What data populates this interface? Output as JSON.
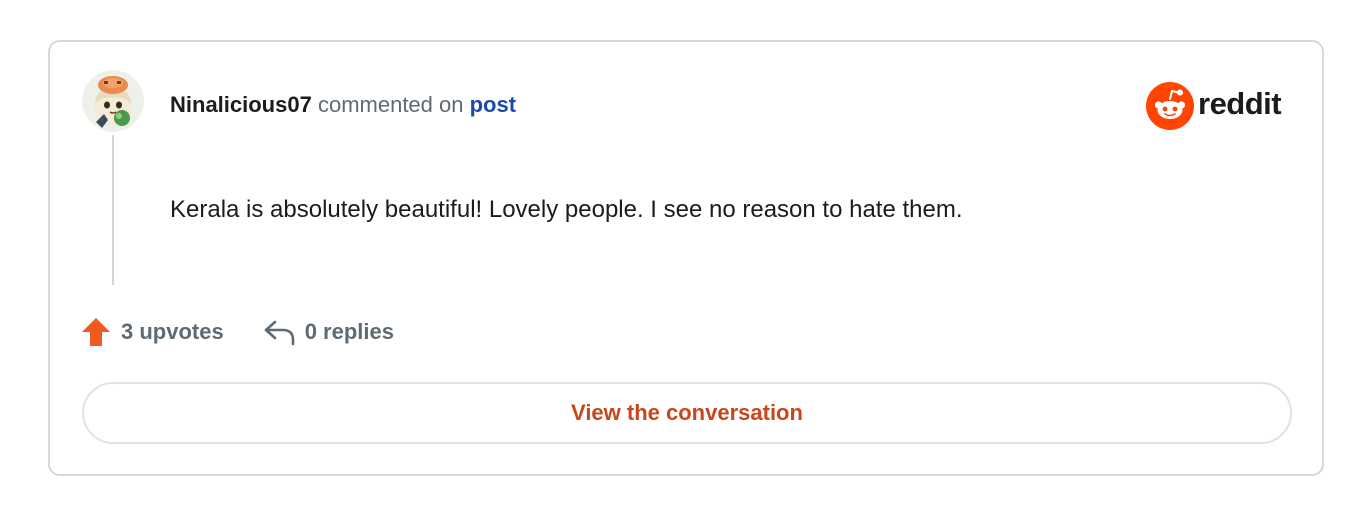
{
  "comment": {
    "username": "Ninalicious07",
    "action_text": " commented on ",
    "post_link": "post",
    "body": "Kerala is absolutely beautiful! Lovely people. I see no reason to hate them."
  },
  "brand": {
    "logo_text": "reddit",
    "accent_color": "#ff4500"
  },
  "stats": {
    "upvotes": "3 upvotes",
    "replies": "0 replies"
  },
  "cta": {
    "view_label": "View the conversation"
  },
  "icons": {
    "avatar": "user-avatar",
    "logo": "reddit-snoo-icon",
    "upvote": "upvote-arrow-icon",
    "reply": "reply-arrow-icon"
  }
}
